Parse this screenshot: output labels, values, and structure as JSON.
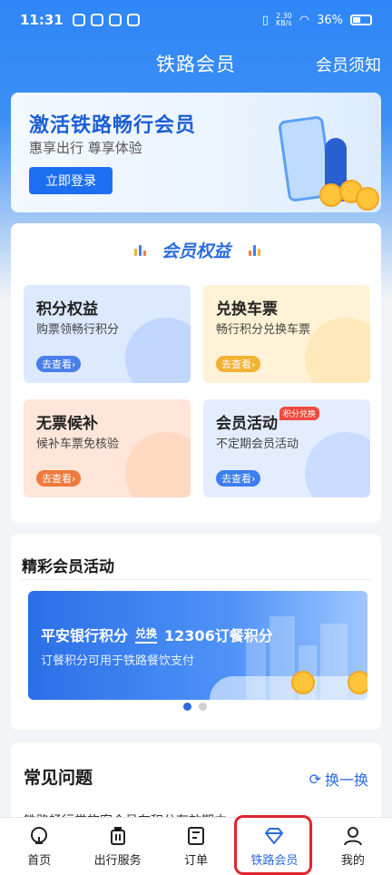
{
  "status_bar": {
    "time": "11:31",
    "net_speed_top": "2.30",
    "net_speed_bottom": "KB/s",
    "battery": "36%"
  },
  "nav": {
    "title": "铁路会员",
    "right_link": "会员须知"
  },
  "login_banner": {
    "title": "激活铁路畅行会员",
    "subtitle": "惠享出行 尊享体验",
    "button": "立即登录"
  },
  "benefits": {
    "title": "会员权益",
    "tiles": [
      {
        "title": "积分权益",
        "subtitle": "购票领畅行积分",
        "button": "去查看›",
        "bg": "#dce9ff",
        "btn_color": "#4a7fe8"
      },
      {
        "title": "兑换车票",
        "subtitle": "畅行积分兑换车票",
        "button": "去查看›",
        "bg": "#fff2d6",
        "btn_color": "#f2b233"
      },
      {
        "title": "无票候补",
        "subtitle": "候补车票免核验",
        "button": "去查看›",
        "bg": "#ffe6d8",
        "btn_color": "#f07a3c"
      },
      {
        "title": "会员活动",
        "subtitle": "不定期会员活动",
        "button": "去查看›",
        "badge": "积分兑换",
        "bg": "#e3edff",
        "btn_color": "#3d7ef0"
      }
    ]
  },
  "activities": {
    "title": "精彩会员活动",
    "banner": {
      "from": "平安银行积分",
      "exchange": "兑换",
      "to": "12306订餐积分",
      "desc": "订餐积分可用于铁路餐饮支付"
    },
    "carousel": {
      "active_index": 0,
      "count": 2
    }
  },
  "faq": {
    "title": "常见问题",
    "refresh": "换一换",
    "first_item": "铁路畅行常旅客会员在积分有效期内…"
  },
  "tabbar": {
    "items": [
      {
        "label": "首页",
        "icon": "home-icon"
      },
      {
        "label": "出行服务",
        "icon": "luggage-icon"
      },
      {
        "label": "订单",
        "icon": "order-list-icon"
      },
      {
        "label": "铁路会员",
        "icon": "diamond-icon"
      },
      {
        "label": "我的",
        "icon": "person-icon"
      }
    ],
    "active_index": 3
  },
  "colors": {
    "primary": "#2a6be0",
    "header_blue": "#2f86f6",
    "highlight_red": "#e0252f"
  }
}
